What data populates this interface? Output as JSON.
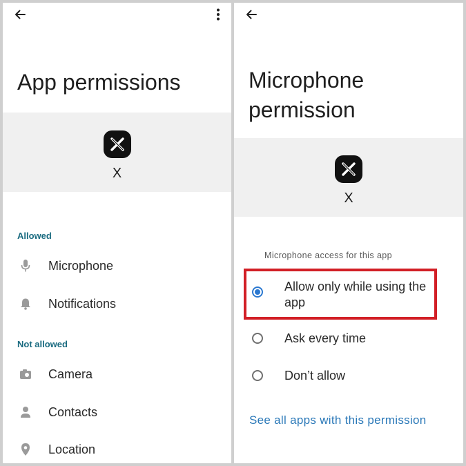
{
  "left_screen": {
    "title": "App permissions",
    "app": {
      "name": "X",
      "logo_glyph": "X"
    },
    "allowed_section_label": "Allowed",
    "allowed": [
      {
        "label": "Microphone",
        "icon": "microphone-icon"
      },
      {
        "label": "Notifications",
        "icon": "bell-icon"
      }
    ],
    "not_allowed_section_label": "Not allowed",
    "not_allowed": [
      {
        "label": "Camera",
        "icon": "camera-icon"
      },
      {
        "label": "Contacts",
        "icon": "person-icon"
      },
      {
        "label": "Location",
        "icon": "location-pin-icon"
      }
    ],
    "icons": {
      "back": "back-arrow-icon",
      "menu": "more-vert-icon"
    }
  },
  "right_screen": {
    "title_line1": "Microphone",
    "title_line2": "permission",
    "app": {
      "name": "X",
      "logo_glyph": "X"
    },
    "access_label": "Microphone access for this app",
    "options": [
      {
        "label": "Allow only while using the app",
        "selected": true
      },
      {
        "label": "Ask every time",
        "selected": false
      },
      {
        "label": "Don’t allow",
        "selected": false
      }
    ],
    "link_text": "See all apps with this permission",
    "icons": {
      "back": "back-arrow-icon"
    }
  },
  "colors": {
    "accent_teal": "#1a6b80",
    "radio_selected": "#2a78d0",
    "link": "#2a78b8",
    "highlight": "#d21f26",
    "header_background": "#f0f0f0"
  }
}
